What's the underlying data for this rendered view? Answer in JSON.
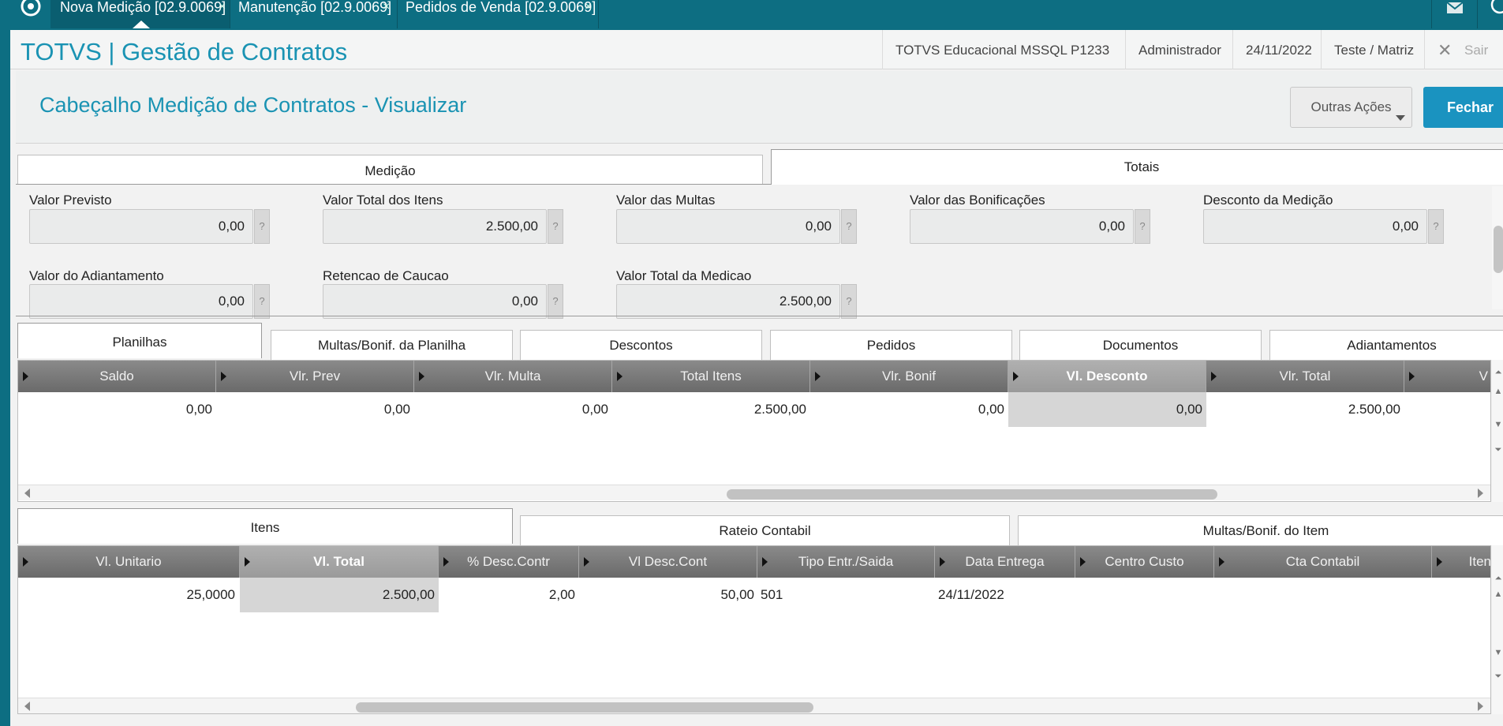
{
  "top_tabs": [
    {
      "label": "Nova Medição [02.9.0069]",
      "close": "×"
    },
    {
      "label": "Manutenção [02.9.0069]",
      "close": "×"
    },
    {
      "label": "Pedidos de Venda [02.9.0069]",
      "close": "×"
    }
  ],
  "header": {
    "brand": "TOTVS | Gestão de Contratos",
    "environment": "TOTVS Educacional MSSQL P1233",
    "user": "Administrador",
    "date": "24/11/2022",
    "branch": "Teste / Matriz",
    "exit_label": "Sair"
  },
  "page": {
    "title": "Cabeçalho Medição de Contratos - Visualizar",
    "other_actions_label": "Outras Ações",
    "close_label": "Fechar"
  },
  "folder_tabs": {
    "medicao": "Medição",
    "totais": "Totais"
  },
  "totals": {
    "help": "?",
    "fields": [
      {
        "label": "Valor Previsto",
        "value": "0,00"
      },
      {
        "label": "Valor Total dos Itens",
        "value": "2.500,00"
      },
      {
        "label": "Valor das Multas",
        "value": "0,00"
      },
      {
        "label": "Valor das Bonificações",
        "value": "0,00"
      },
      {
        "label": "Desconto da Medição",
        "value": "0,00"
      },
      {
        "label": "Valor do Adiantamento",
        "value": "0,00"
      },
      {
        "label": "Retencao de Caucao",
        "value": "0,00"
      },
      {
        "label": "Valor Total da Medicao",
        "value": "2.500,00"
      }
    ]
  },
  "mid_tabs": [
    "Planilhas",
    "Multas/Bonif. da Planilha",
    "Descontos",
    "Pedidos",
    "Documentos",
    "Adiantamentos"
  ],
  "planilhas_grid": {
    "columns": [
      "Saldo",
      "Vlr. Prev",
      "Vlr. Multa",
      "Total Itens",
      "Vlr. Bonif",
      "Vl. Desconto",
      "Vlr. Total",
      "V"
    ],
    "row": [
      "0,00",
      "0,00",
      "0,00",
      "2.500,00",
      "0,00",
      "0,00",
      "2.500,00"
    ]
  },
  "bottom_tabs": [
    "Itens",
    "Rateio Contabil",
    "Multas/Bonif. do Item"
  ],
  "itens_grid": {
    "columns": [
      "Vl. Unitario",
      "Vl. Total",
      "% Desc.Contr",
      "Vl Desc.Cont",
      "Tipo Entr./Saida",
      "Data Entrega",
      "Centro Custo",
      "Cta Contabil",
      "Iten"
    ],
    "row": [
      "25,0000",
      "2.500,00",
      "2,00",
      "50,00",
      "501",
      "24/11/2022",
      "",
      ""
    ]
  },
  "colors": {
    "teal_bar": "#0d6e82",
    "accent": "#1a93b3",
    "primary_button": "#1a93c0"
  }
}
